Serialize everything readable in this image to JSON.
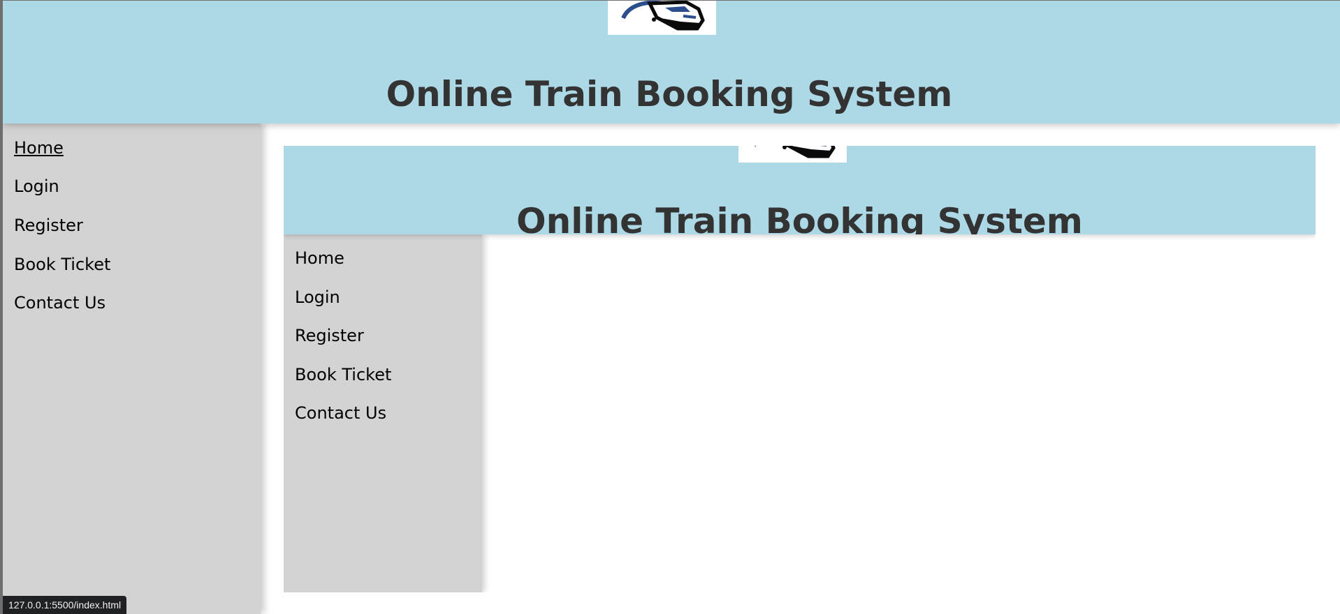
{
  "header": {
    "logo_icon": "train-icon",
    "title": "Online Train Booking System"
  },
  "nav": {
    "items": [
      {
        "label": "Home",
        "active": true
      },
      {
        "label": "Login"
      },
      {
        "label": "Register"
      },
      {
        "label": "Book Ticket"
      },
      {
        "label": "Contact Us"
      }
    ]
  },
  "embedded_page": {
    "header": {
      "logo_icon": "train-icon",
      "title": "Online Train Booking System"
    },
    "nav": {
      "items": [
        {
          "label": "Home"
        },
        {
          "label": "Login"
        },
        {
          "label": "Register"
        },
        {
          "label": "Book Ticket"
        },
        {
          "label": "Contact Us"
        }
      ]
    }
  },
  "status_bar": {
    "url": "127.0.0.1:5500/index.html"
  },
  "colors": {
    "header_bg": "#add8e6",
    "sidebar_bg": "#d3d3d3",
    "title_text": "#333333",
    "logo_blue": "#2b4f8c"
  }
}
